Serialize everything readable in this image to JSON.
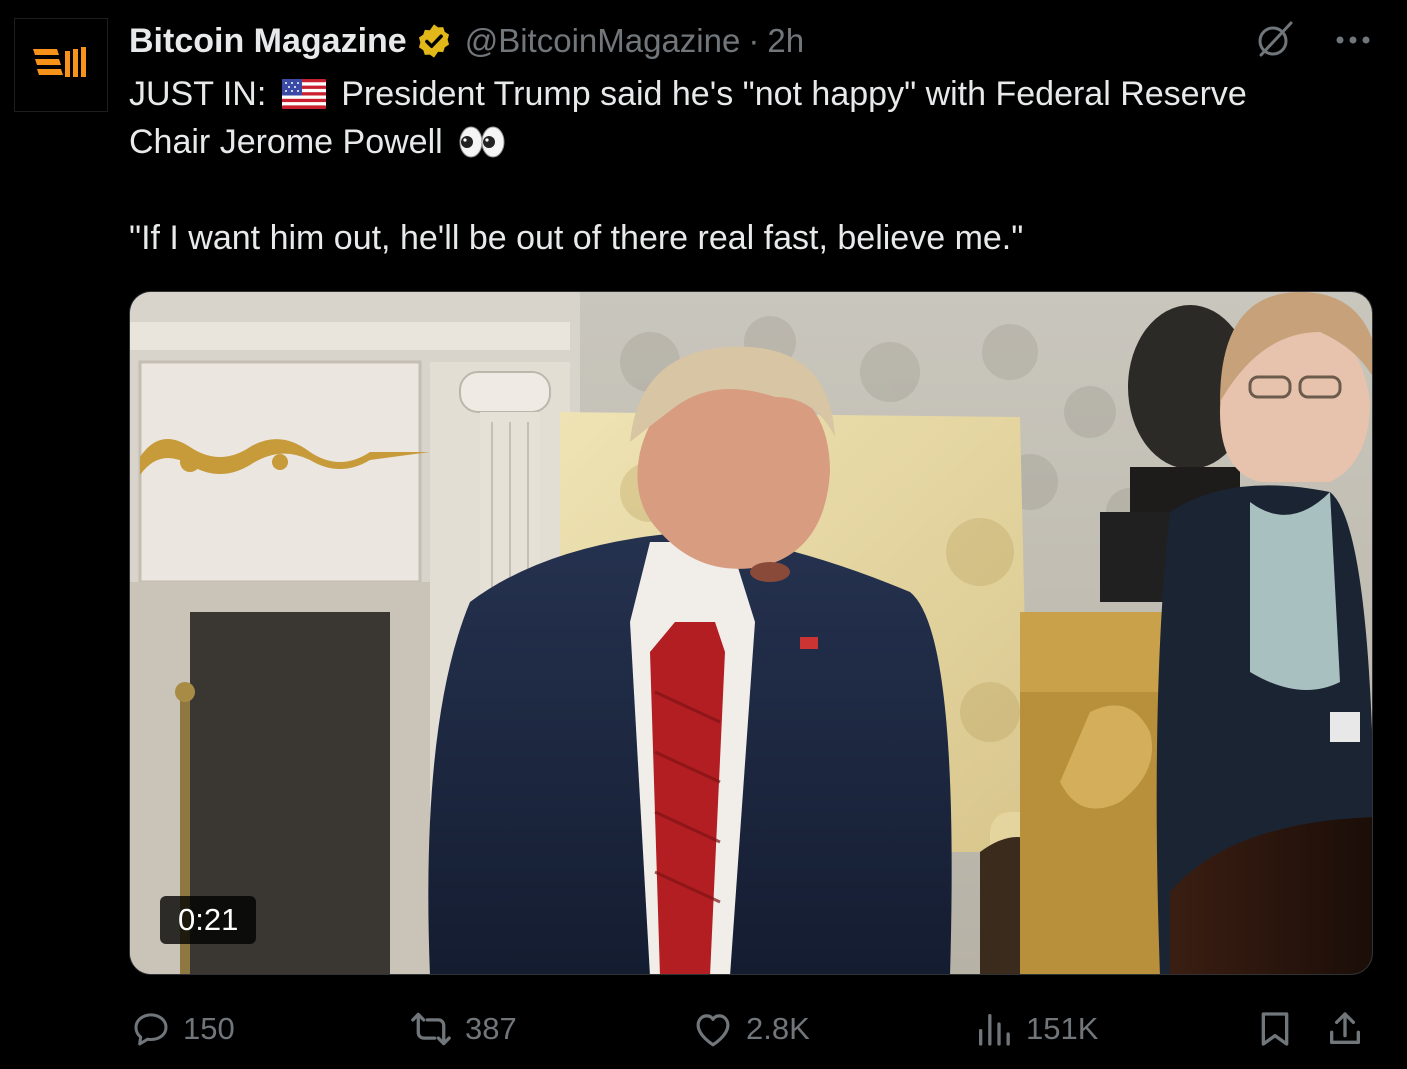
{
  "account": {
    "display_name": "Bitcoin Magazine",
    "handle": "@BitcoinMagazine",
    "separator": "·",
    "time": "2h",
    "verified_badge_color": "#e2b719"
  },
  "tweet": {
    "line1_prefix": "JUST IN:",
    "line1_suffix": "President Trump said he's \"not happy\" with Federal Reserve",
    "line2": "Chair Jerome Powell",
    "quote": "\"If I want him out, he'll be out of there real fast, believe me.\""
  },
  "media": {
    "duration": "0:21"
  },
  "metrics": {
    "replies": "150",
    "reposts": "387",
    "likes": "2.8K",
    "views": "151K"
  },
  "colors": {
    "background": "#000000",
    "text": "#e7e9ea",
    "muted": "#71767b",
    "brand": "#f7931a"
  },
  "icons": [
    "bitcoin-magazine-logo",
    "verified-badge-icon",
    "grok-icon",
    "more-icon",
    "us-flag-emoji",
    "eyes-emoji",
    "reply-icon",
    "repost-icon",
    "like-icon",
    "views-icon",
    "bookmark-icon",
    "share-icon"
  ]
}
